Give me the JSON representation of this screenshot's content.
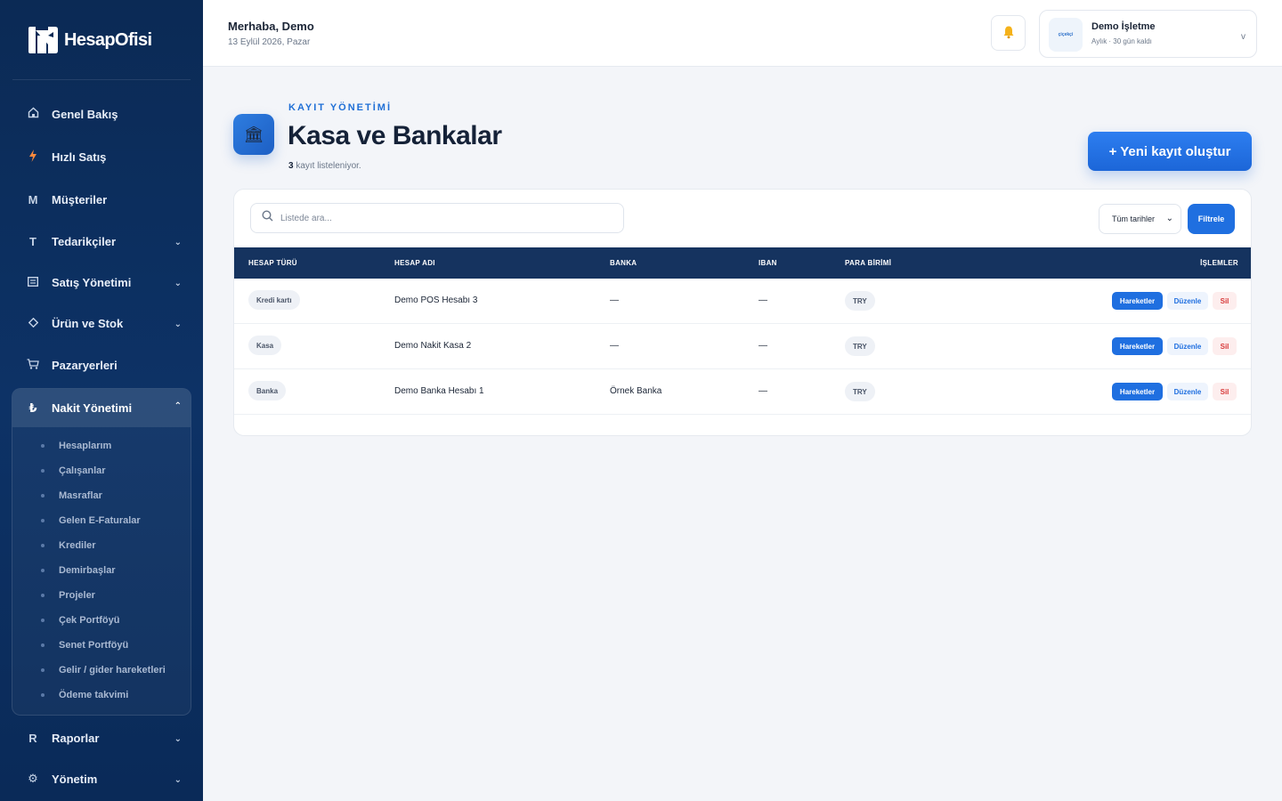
{
  "brand": {
    "name": "HesapOfisi"
  },
  "sidebar": {
    "items": [
      {
        "label": "Genel Bakış",
        "icon": "home-icon"
      },
      {
        "label": "Hızlı Satış",
        "icon": "bolt-icon"
      },
      {
        "label": "Müşteriler",
        "icon": "M"
      },
      {
        "label": "Tedarikçiler",
        "icon": "T"
      },
      {
        "label": "Satış Yönetimi",
        "icon": "list-icon"
      },
      {
        "label": "Ürün ve Stok",
        "icon": "diamond-icon"
      },
      {
        "label": "Pazaryerleri",
        "icon": "cart-icon"
      },
      {
        "label": "Raporlar",
        "icon": "R"
      },
      {
        "label": "Yönetim",
        "icon": "gear-icon"
      }
    ],
    "active_group": {
      "label": "Nakit Yönetimi",
      "icon": "₺",
      "sub_items": [
        "Hesaplarım",
        "Çalışanlar",
        "Masraflar",
        "Gelen E-Faturalar",
        "Krediler",
        "Demirbaşlar",
        "Projeler",
        "Çek Portföyü",
        "Senet Portföyü",
        "Gelir / gider hareketleri",
        "Ödeme takvimi"
      ]
    }
  },
  "header": {
    "greeting": "Merhaba, Demo",
    "date": "13 Eylül 2026, Pazar",
    "business": {
      "logo_text": "çiçekçi",
      "name": "Demo İşletme",
      "plan": "Aylık · 30 gün kaldı",
      "chevron": "v"
    }
  },
  "page": {
    "eyebrow": "KAYIT YÖNETİMİ",
    "title": "Kasa ve Bankalar",
    "count": "3",
    "count_suffix": " kayıt listeleniyor.",
    "new_button": "+ Yeni kayıt oluştur"
  },
  "toolbar": {
    "search_placeholder": "Listede ara...",
    "date_filter": "Tüm tarihler",
    "filter_button": "Filtrele"
  },
  "table": {
    "columns": [
      "HESAP TÜRÜ",
      "HESAP ADI",
      "BANKA",
      "IBAN",
      "PARA BİRİMİ",
      "İŞLEMLER"
    ],
    "rows": [
      {
        "type": "Kredi kartı",
        "name": "Demo POS Hesabı 3",
        "bank": "—",
        "iban": "—",
        "currency": "TRY"
      },
      {
        "type": "Kasa",
        "name": "Demo Nakit Kasa 2",
        "bank": "—",
        "iban": "—",
        "currency": "TRY"
      },
      {
        "type": "Banka",
        "name": "Demo Banka Hesabı 1",
        "bank": "Örnek Banka",
        "iban": "—",
        "currency": "TRY"
      }
    ],
    "actions": {
      "movements": "Hareketler",
      "edit": "Düzenle",
      "delete": "Sil"
    }
  },
  "colors": {
    "sidebar": "#0b2a55",
    "accent": "#1f6fe0",
    "table_header": "#15335f",
    "danger": "#d83a3a"
  }
}
